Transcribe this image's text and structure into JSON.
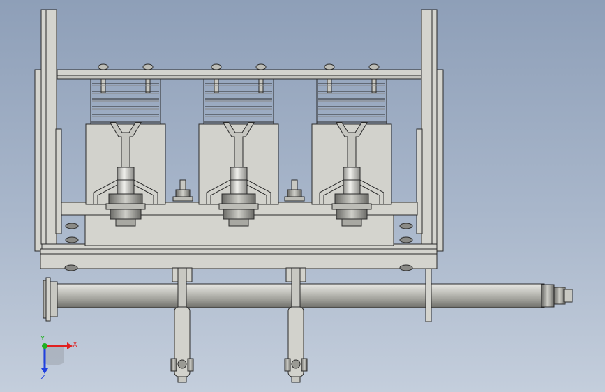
{
  "view": {
    "background_top": "#8e9fb8",
    "background_bottom": "#c4cedc"
  },
  "model": {
    "part_color": "#d2d2cc",
    "edge_color": "#2a2a2a",
    "shaft_color": "#b4b4ae",
    "pole_count": 3,
    "lever_count": 2
  },
  "triad": {
    "x_label": "X",
    "y_label": "Y",
    "z_label": "Z",
    "x_color": "#e02020",
    "y_color": "#20b020",
    "z_color": "#2040e0"
  }
}
